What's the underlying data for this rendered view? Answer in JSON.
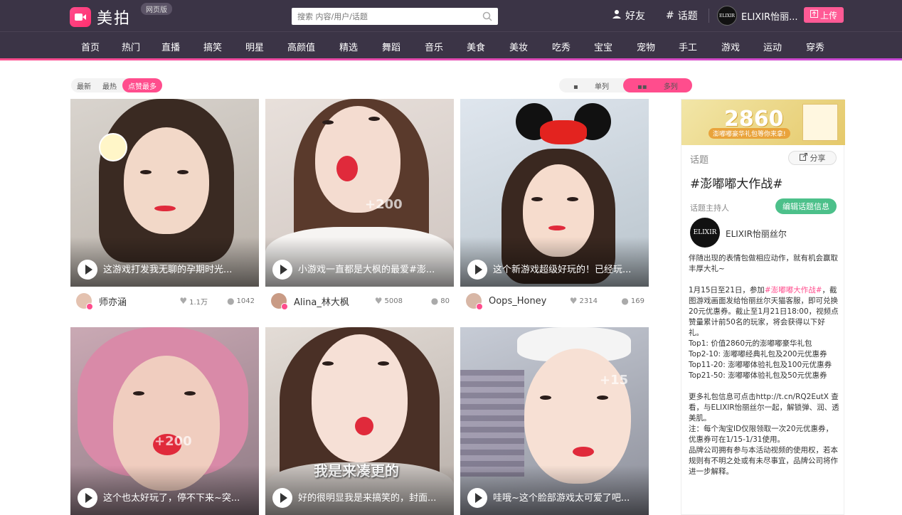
{
  "header": {
    "logo_text": "美拍",
    "web_badge": "网页版",
    "search_placeholder": "搜索 内容/用户/话题",
    "friends_label": "好友",
    "topics_label": "话题",
    "user_name": "ELIXIR怡丽...",
    "avatar_text": "ELIXIR",
    "upload_label": "上传"
  },
  "categories": [
    "首页",
    "热门",
    "直播",
    "搞笑",
    "明星",
    "高颜值",
    "精选",
    "舞蹈",
    "音乐",
    "美食",
    "美妆",
    "吃秀",
    "宝宝",
    "宠物",
    "手工",
    "游戏",
    "运动",
    "穿秀"
  ],
  "sort_tabs": [
    "最新",
    "最热",
    "点赞最多"
  ],
  "sort_active": "点赞最多",
  "view_tabs": [
    "单列",
    "多列"
  ],
  "view_active": "多列",
  "videos": [
    {
      "caption": "这游戏打发我无聊的孕期时光...",
      "user": "师亦涵",
      "likes": "1.1万",
      "comments": "1042"
    },
    {
      "caption": "小游戏一直都是大枫的最爱#澎...",
      "user": "Alina_林大枫",
      "likes": "5008",
      "comments": "80"
    },
    {
      "caption": "这个新游戏超级好玩的！已经玩...",
      "user": "Oops_Honey",
      "likes": "2314",
      "comments": "169"
    },
    {
      "caption": "这个也太好玩了，停不下来~突...",
      "user": "",
      "likes": "",
      "comments": ""
    },
    {
      "caption": "好的很明显我是来搞笑的，封面...",
      "user": "",
      "likes": "",
      "comments": ""
    },
    {
      "caption": "哇哦~这个脸部游戏太可爱了吧...",
      "user": "",
      "likes": "",
      "comments": ""
    }
  ],
  "overlays": {
    "plus200": "+200",
    "plus15": "+15",
    "subtitle": "我是来凑更的"
  },
  "sidebar": {
    "banner_big": "2860",
    "banner_sub": "澎嘟嘟豪华礼包等你来拿!",
    "topic_label": "话题",
    "share_label": "分享",
    "topic_title": "#澎嘟嘟大作战#",
    "host_label": "话题主持人",
    "edit_label": "编辑话题信息",
    "host_avatar_text": "ELIXIR",
    "host_name": "ELIXIR怡丽丝尔",
    "desc_intro": "伴随出现的表情包做相应动作，就有机会赢取丰厚大礼~",
    "desc_p1_a": "1月15日至21日，参加",
    "desc_p1_tag": "#澎嘟嘟大作战#",
    "desc_p1_b": "，截图游戏画面发给怡丽丝尔天猫客服，即可兑换20元优惠券。截止至1月21日18:00，视频点赞量累计前50名的玩家，将会获得以下好礼。",
    "prizes": [
      "Top1: 价值2860元的澎嘟嘟豪华礼包",
      "Top2-10: 澎嘟嘟经典礼包及200元优惠券",
      "Top11-20: 澎嘟嘟体验礼包及100元优惠券",
      "Top21-50: 澎嘟嘟体验礼包及50元优惠券"
    ],
    "desc_more": "更多礼包信息可点击http://t.cn/RQ2EutX 查看，与ELIXIR怡丽丝尔一起，解锁弹、润、透美肌。",
    "desc_note": "注：每个淘宝ID仅限领取一次20元优惠券，优惠券可在1/15-1/31使用。",
    "desc_rights": "品牌公司拥有参与本活动视频的使用权，若本规则有不明之处或有未尽事宜，品牌公司将作进一步解释。"
  },
  "colors": {
    "header_bg": "#3b3446",
    "accent": "#ff4d8d",
    "edit_green": "#4cc08a"
  }
}
